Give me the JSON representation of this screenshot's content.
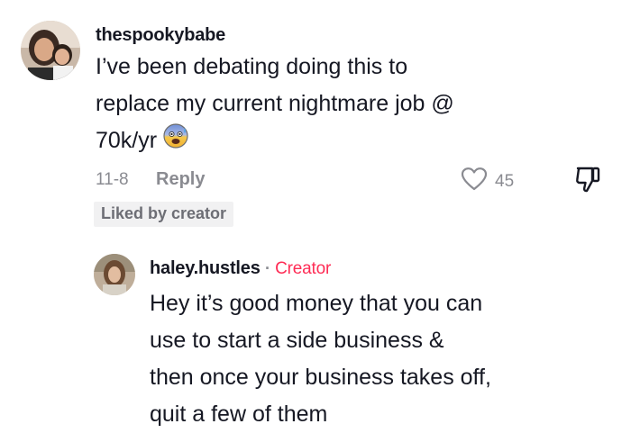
{
  "comment": {
    "username": "thespookybabe",
    "text_lines": [
      "I’ve been debating doing this to",
      "replace my current nightmare job @",
      "70k/yr"
    ],
    "emoji_icon": "anxious-face-with-sweat-icon",
    "date": "11-8",
    "reply_label": "Reply",
    "like_count": "45",
    "liked_badge": "Liked by creator"
  },
  "reply": {
    "username": "haley.hustles",
    "separator": "·",
    "creator_label": "Creator",
    "text_lines": [
      "Hey it’s good money that you can",
      "use to start a side business &",
      "then once your business takes off,",
      "quit a few of them"
    ]
  },
  "colors": {
    "text": "#161823",
    "muted": "#8a8b91",
    "creator": "#fe2c55",
    "badge_bg": "#f1f1f2"
  }
}
